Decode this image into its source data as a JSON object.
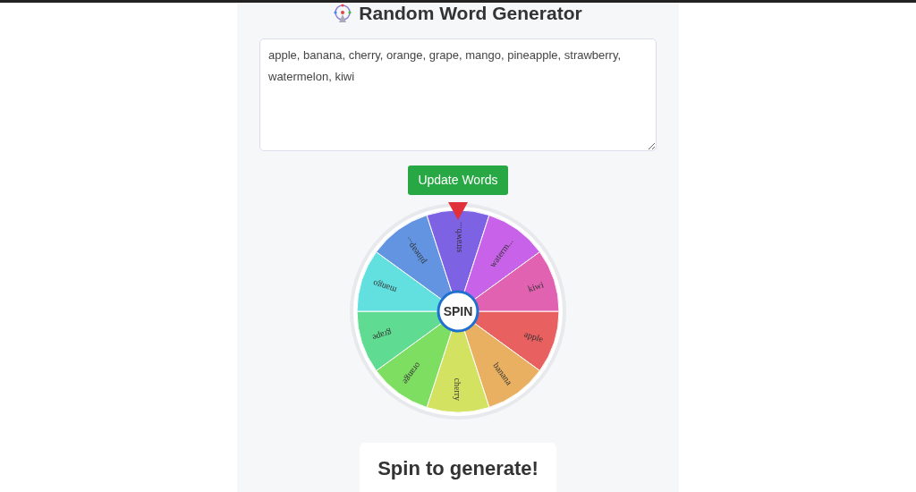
{
  "title": "Random Word Generator",
  "words_input": {
    "value": "apple, banana, cherry, orange, grape, mango, pineapple, strawberry, watermelon, kiwi"
  },
  "update_button": {
    "label": "Update Words"
  },
  "wheel": {
    "spin_label": "SPIN",
    "segments": [
      {
        "label": "apple",
        "color": "#e8605f"
      },
      {
        "label": "banana",
        "color": "#e8b060"
      },
      {
        "label": "cherry",
        "color": "#d4e262"
      },
      {
        "label": "orange",
        "color": "#7ede62"
      },
      {
        "label": "grape",
        "color": "#60dc92"
      },
      {
        "label": "mango",
        "color": "#62e0e0"
      },
      {
        "label": "pineap...",
        "color": "#6294e2"
      },
      {
        "label": "strawb...",
        "color": "#7d62e4"
      },
      {
        "label": "waterm...",
        "color": "#c862e8"
      },
      {
        "label": "kiwi",
        "color": "#e262b2"
      }
    ]
  },
  "result": "Spin to generate!"
}
